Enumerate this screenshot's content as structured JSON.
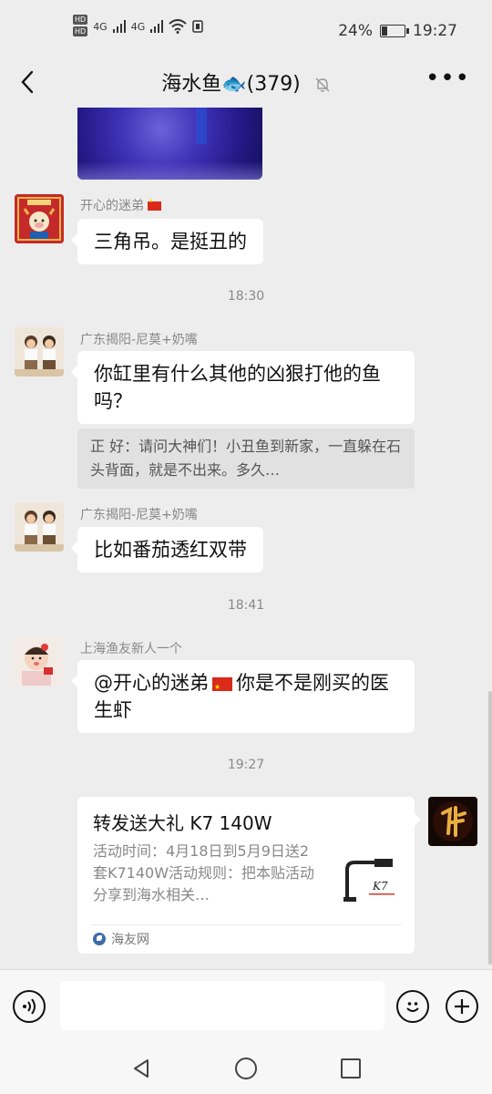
{
  "status": {
    "battery": "24%",
    "battery_level": 0.24,
    "time": "19:27",
    "hd1": "HD",
    "hd2": "HD",
    "net1": "4G",
    "net2": "4G"
  },
  "header": {
    "title": "海水鱼🐟(379)"
  },
  "messages": [
    {
      "sender": "开心的迷弟",
      "text": "三角吊。是挺丑的"
    },
    {
      "time": "18:30"
    },
    {
      "sender": "广东揭阳-尼莫+奶嘴",
      "text": "你缸里有什么其他的凶狠打他的鱼吗？",
      "quote": "正 好：请问大神们！小丑鱼到新家，一直躲在石头背面，就是不出来。多久…"
    },
    {
      "sender": "广东揭阳-尼莫+奶嘴",
      "text": "比如番茄透红双带"
    },
    {
      "time": "18:41"
    },
    {
      "sender": "上海渔友新人一个",
      "mention": "@开心的迷弟",
      "text": "你是不是刚买的医生虾"
    },
    {
      "time": "19:27"
    }
  ],
  "card": {
    "title": "转发送大礼 K7 140W",
    "desc": "活动时间：4月18日到5月9日送2套K7140W活动规则：把本贴活动分享到海水相关…",
    "source": "海友网"
  },
  "icons": {
    "back": "chevron-left-icon",
    "mute": "bell-off-icon",
    "more": "more-dots-icon",
    "voice": "voice-icon",
    "emoji": "emoji-icon",
    "plus": "plus-icon"
  },
  "colors": {
    "background": "#ededed",
    "bubble": "#ffffff",
    "quote": "#e1e1e1",
    "flag": "#d92a1a"
  }
}
